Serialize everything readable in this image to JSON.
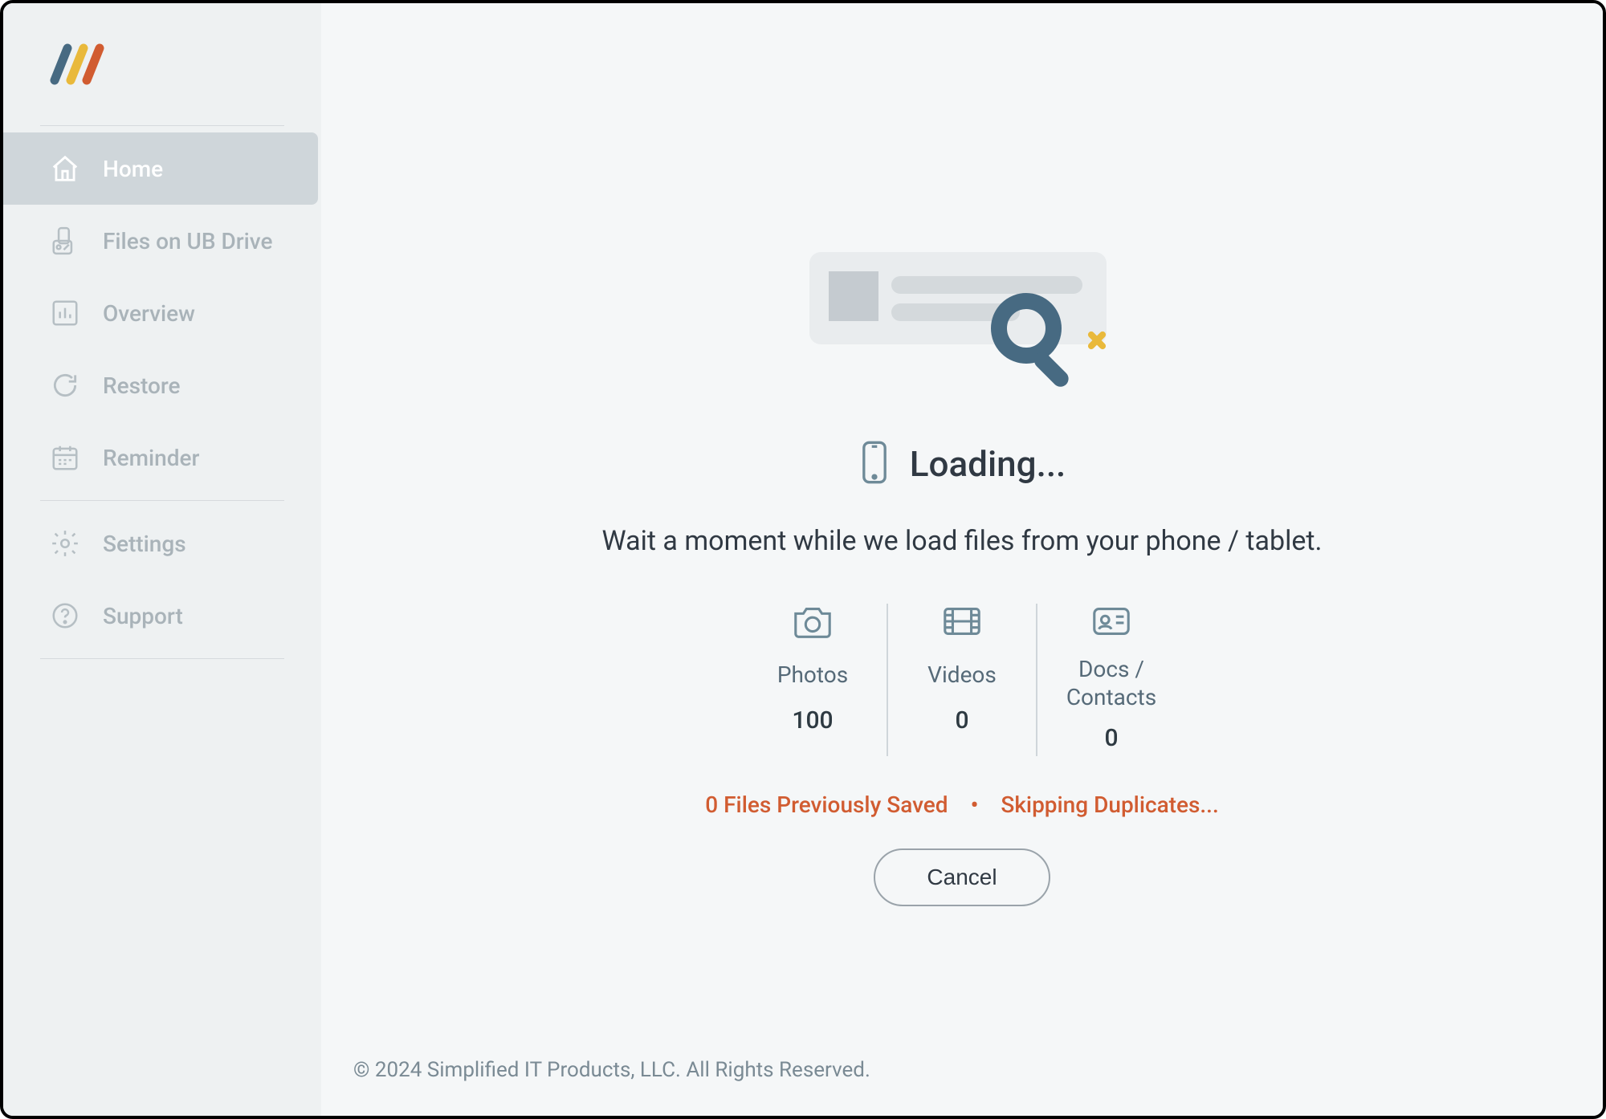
{
  "sidebar": {
    "items": [
      {
        "label": "Home"
      },
      {
        "label": "Files on UB Drive"
      },
      {
        "label": "Overview"
      },
      {
        "label": "Restore"
      },
      {
        "label": "Reminder"
      },
      {
        "label": "Settings"
      },
      {
        "label": "Support"
      }
    ]
  },
  "main": {
    "loading_title": "Loading...",
    "subtitle": "Wait a moment while we load files from your phone / tablet.",
    "stats": {
      "photos": {
        "label": "Photos",
        "value": "100"
      },
      "videos": {
        "label": "Videos",
        "value": "0"
      },
      "docs": {
        "label": "Docs / Contacts",
        "value": "0"
      }
    },
    "status": {
      "prev_saved": "0 Files Previously Saved",
      "skipping": "Skipping Duplicates..."
    },
    "cancel_label": "Cancel"
  },
  "footer": {
    "copyright": "© 2024 Simplified IT Products, LLC. All Rights Reserved."
  }
}
